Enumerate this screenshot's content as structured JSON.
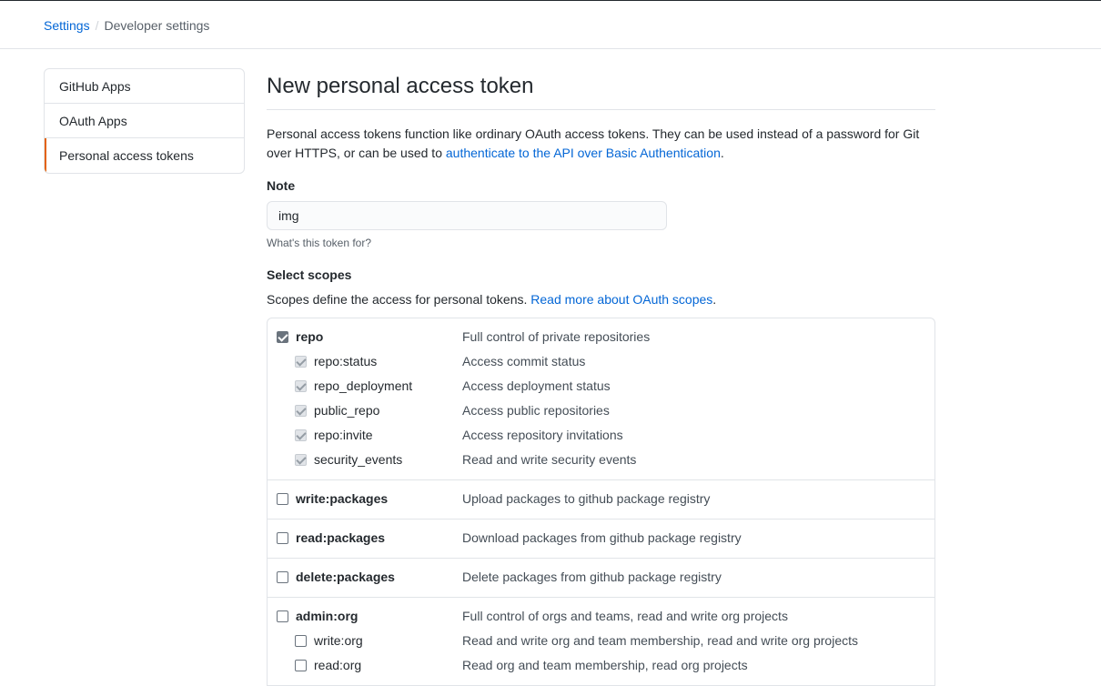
{
  "breadcrumb": {
    "settings": "Settings",
    "separator": "/",
    "current": "Developer settings"
  },
  "sidebar": {
    "items": [
      {
        "label": "GitHub Apps"
      },
      {
        "label": "OAuth Apps"
      },
      {
        "label": "Personal access tokens"
      }
    ],
    "selected_color": "#e36209"
  },
  "main": {
    "title": "New personal access token",
    "description_before": "Personal access tokens function like ordinary OAuth access tokens. They can be used instead of a password for Git over HTTPS, or can be used to ",
    "description_link": "authenticate to the API over Basic Authentication",
    "description_after": ".",
    "note_label": "Note",
    "note_value": "img",
    "note_hint": "What's this token for?",
    "scopes_label": "Select scopes",
    "scopes_desc_before": "Scopes define the access for personal tokens. ",
    "scopes_desc_link": "Read more about OAuth scopes",
    "scopes_desc_after": "."
  },
  "scopes": {
    "repo": {
      "name": "repo",
      "desc": "Full control of private repositories",
      "checked": true
    },
    "repo_children": [
      {
        "name": "repo:status",
        "desc": "Access commit status"
      },
      {
        "name": "repo_deployment",
        "desc": "Access deployment status"
      },
      {
        "name": "public_repo",
        "desc": "Access public repositories"
      },
      {
        "name": "repo:invite",
        "desc": "Access repository invitations"
      },
      {
        "name": "security_events",
        "desc": "Read and write security events"
      }
    ],
    "write_packages": {
      "name": "write:packages",
      "desc": "Upload packages to github package registry",
      "checked": false
    },
    "read_packages": {
      "name": "read:packages",
      "desc": "Download packages from github package registry",
      "checked": false
    },
    "delete_packages": {
      "name": "delete:packages",
      "desc": "Delete packages from github package registry",
      "checked": false
    },
    "admin_org": {
      "name": "admin:org",
      "desc": "Full control of orgs and teams, read and write org projects",
      "checked": false
    },
    "admin_org_children": [
      {
        "name": "write:org",
        "desc": "Read and write org and team membership, read and write org projects"
      },
      {
        "name": "read:org",
        "desc": "Read org and team membership, read org projects"
      }
    ]
  },
  "colors": {
    "link": "#0366d6",
    "border": "#e1e4e8"
  }
}
